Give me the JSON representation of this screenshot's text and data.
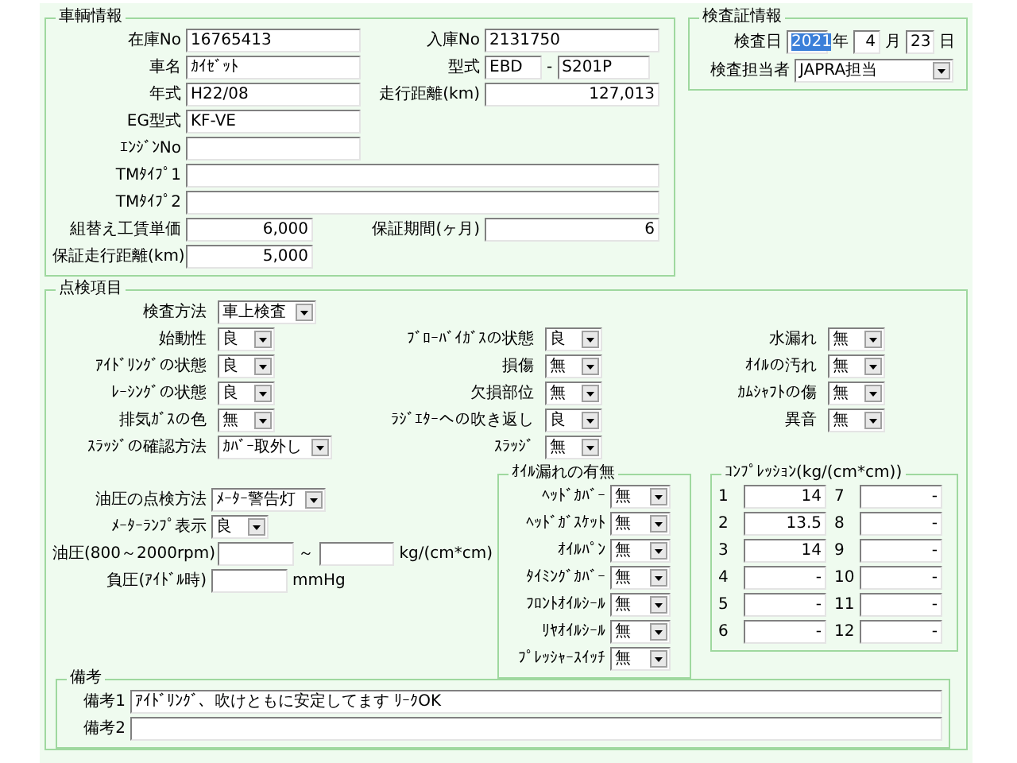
{
  "vehicle_info": {
    "title": "車輌情報",
    "rows": [
      [
        {
          "label": "在庫No",
          "value": "16765413",
          "kind": "text"
        },
        {
          "label": "入庫No",
          "value": "2131750",
          "kind": "text"
        }
      ],
      [
        {
          "label": "車名",
          "value": "ｶｲｾﾞｯﾄ",
          "kind": "text"
        },
        {
          "label": "型式",
          "value": "EBD",
          "separator": "-",
          "value_2": "S201P",
          "kind": "pair"
        }
      ],
      [
        {
          "label": "年式",
          "value": "H22/08",
          "kind": "text"
        },
        {
          "label": "走行距離(km)",
          "value": "127,013",
          "kind": "number"
        }
      ],
      [
        {
          "label": "EG型式",
          "value": "KF-VE",
          "kind": "text"
        }
      ],
      [
        {
          "label": "ｴﾝｼﾞﾝNo",
          "kind": "text"
        }
      ],
      [
        {
          "label": "TMﾀｲﾌﾟ1",
          "kind": "long"
        }
      ],
      [
        {
          "label": "TMﾀｲﾌﾟ2",
          "kind": "long"
        }
      ],
      [
        {
          "label": "組替え工賃単価",
          "value": "6,000",
          "kind": "number"
        },
        {
          "label": "保証期間(ヶ月)",
          "value": "6",
          "kind": "number"
        }
      ],
      [
        {
          "label": "保証走行距離(km)",
          "value": "5,000",
          "kind": "number"
        }
      ]
    ]
  },
  "inspection_certificate": {
    "title": "検査証情報",
    "date": {
      "label": "検査日",
      "parts": [
        {
          "value": "2021",
          "unit": "年",
          "selected": true
        },
        {
          "value": "4",
          "unit": "月",
          "selected": false
        },
        {
          "value": "23",
          "unit": "日",
          "selected": false
        }
      ]
    },
    "inspector": {
      "label": "検査担当者",
      "value": "JAPRA担当"
    }
  },
  "check_items": {
    "title": "点検項目",
    "method": {
      "label": "検査方法",
      "value": "車上検査"
    },
    "columns": [
      [
        {
          "label": "始動性",
          "value": "良"
        },
        {
          "label": "ｱｲﾄﾞﾘﾝｸﾞの状態",
          "value": "良"
        },
        {
          "label": "ﾚｰｼﾝｸﾞの状態",
          "value": "良"
        },
        {
          "label": "排気ｶﾞｽの色",
          "value": "無"
        },
        {
          "label": "ｽﾗｯｼﾞの確認方法",
          "value": "ｶﾊﾞｰ取外し"
        }
      ],
      [
        {
          "label": "ﾌﾞﾛｰﾊﾞｲｶﾞｽの状態",
          "value": "良"
        },
        {
          "label": "損傷",
          "value": "無"
        },
        {
          "label": "欠損部位",
          "value": "無"
        },
        {
          "label": "ﾗｼﾞｴﾀｰへの吹き返し",
          "value": "良"
        },
        {
          "label": "ｽﾗｯｼﾞ",
          "value": "無"
        }
      ],
      [
        {
          "label": "水漏れ",
          "value": "無"
        },
        {
          "label": "ｵｲﾙの汚れ",
          "value": "無"
        },
        {
          "label": "ｶﾑｼｬﾌﾄの傷",
          "value": "無"
        },
        {
          "label": "異音",
          "value": "無"
        }
      ]
    ],
    "oil_pressure": {
      "method": {
        "label": "油圧の点検方法",
        "value": "ﾒｰﾀｰ警告灯"
      },
      "lamp": {
        "label": "ﾒｰﾀｰﾗﾝﾌﾟ表示",
        "value": "良"
      },
      "pressure": {
        "label": "油圧(800～2000rpm)",
        "separator": "～",
        "unit": "kg/(cm*cm)"
      },
      "vacuum": {
        "label": "負圧(ｱｲﾄﾞﾙ時)",
        "unit": "mmHg"
      }
    },
    "oil_leak": {
      "title": "ｵｲﾙ漏れの有無",
      "items": [
        {
          "label": "ﾍｯﾄﾞｶﾊﾞｰ",
          "value": "無"
        },
        {
          "label": "ﾍｯﾄﾞｶﾞｽｹｯﾄ",
          "value": "無"
        },
        {
          "label": "ｵｲﾙﾊﾟﾝ",
          "value": "無"
        },
        {
          "label": "ﾀｲﾐﾝｸﾞｶﾊﾞｰ",
          "value": "無"
        },
        {
          "label": "ﾌﾛﾝﾄｵｲﾙｼｰﾙ",
          "value": "無"
        },
        {
          "label": "ﾘﾔｵｲﾙｼｰﾙ",
          "value": "無"
        },
        {
          "label": "ﾌﾟﾚｯｼｬｰｽｲｯﾁ",
          "value": "無"
        }
      ]
    },
    "compression": {
      "title": "ｺﾝﾌﾟﾚｯｼｮﾝ(kg/(cm*cm))",
      "cylinders": [
        {
          "number": "1",
          "value": "14"
        },
        {
          "number": "2",
          "value": "13.5"
        },
        {
          "number": "3",
          "value": "14"
        },
        {
          "number": "4",
          "value": "-"
        },
        {
          "number": "5",
          "value": "-"
        },
        {
          "number": "6",
          "value": "-"
        },
        {
          "number": "7",
          "value": "-"
        },
        {
          "number": "8",
          "value": "-"
        },
        {
          "number": "9",
          "value": "-"
        },
        {
          "number": "10",
          "value": "-"
        },
        {
          "number": "11",
          "value": "-"
        },
        {
          "number": "12",
          "value": "-"
        }
      ]
    }
  },
  "remarks": {
    "title": "備考",
    "fields": [
      {
        "label": "備考1",
        "value": "ｱｲﾄﾞﾘﾝｸﾞ、吹けともに安定してます ﾘｰｸOK"
      },
      {
        "label": "備考2"
      }
    ]
  }
}
